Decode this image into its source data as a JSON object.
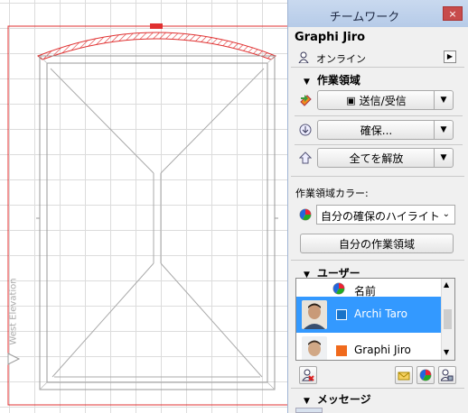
{
  "canvas": {
    "elevation_label": "West Elevation"
  },
  "palette": {
    "title": "チームワーク",
    "close_glyph": "×",
    "user_name": "Graphi Jiro",
    "status": "オンライン",
    "workspace": {
      "header": "作業領域",
      "send_receive": "送信/受信",
      "reserve": "確保...",
      "release_all": "全てを解放"
    },
    "workspace_color": {
      "label": "作業領域カラー:",
      "selected": "自分の確保のハイライト",
      "my_workspace_button": "自分の作業領域"
    },
    "users": {
      "header": "ユーザー",
      "column_name": "名前",
      "rows": [
        {
          "name": "Archi Taro",
          "color": "#1a73c8"
        },
        {
          "name": "Graphi Jiro",
          "color": "#f06a1c"
        }
      ]
    },
    "messages": {
      "header": "メッセージ"
    }
  },
  "colors": {
    "accent_red": "#e03030",
    "selection": "#3399ff"
  }
}
